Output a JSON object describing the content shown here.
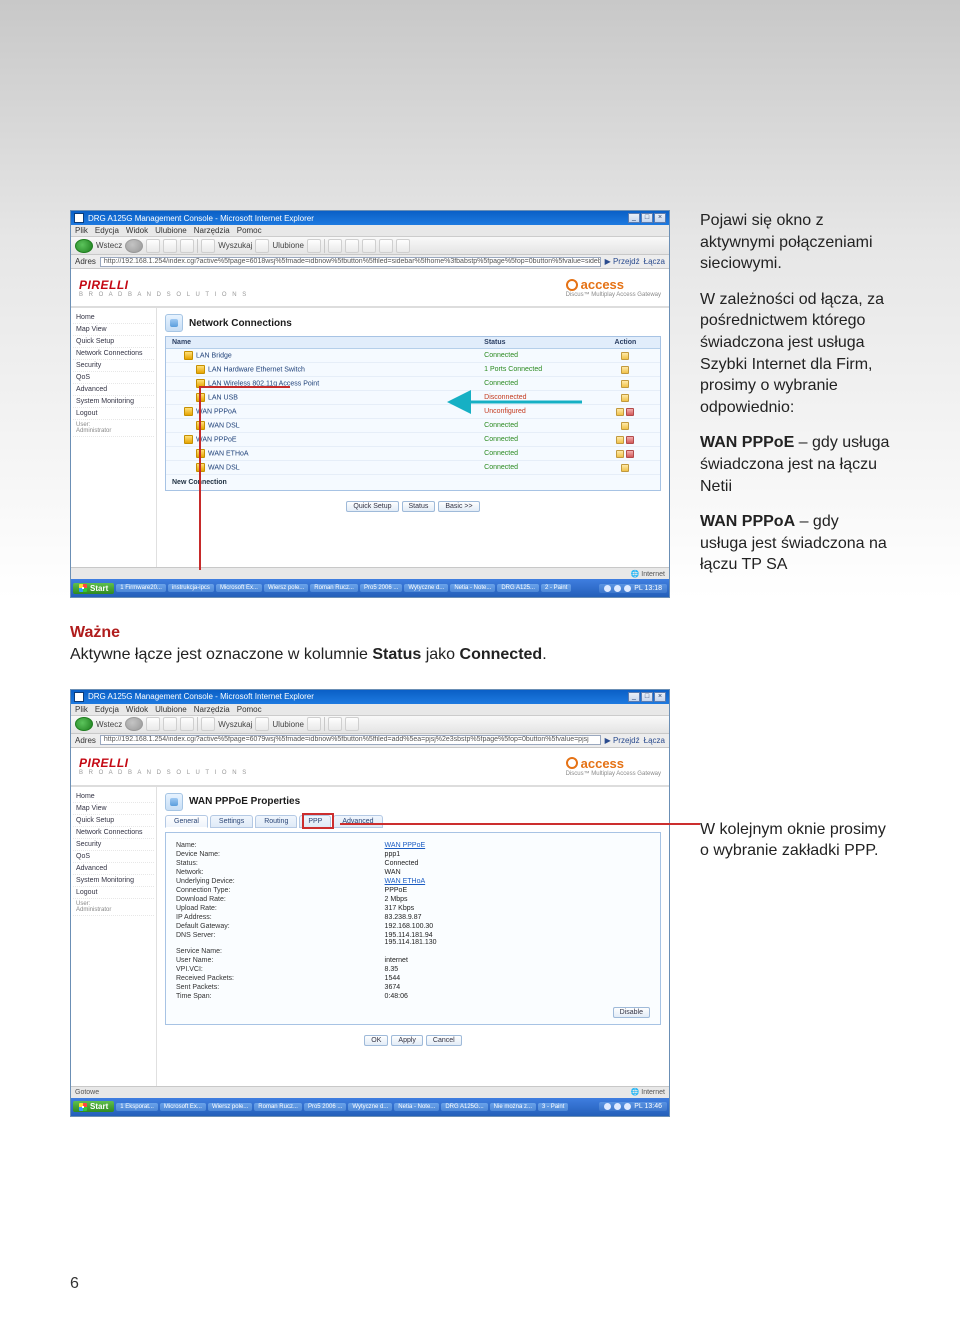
{
  "page_number": "6",
  "annotations": {
    "intro": "Pojawi się okno z aktywnymi połączeniami sieciowymi.",
    "depends": "W zależności od łącza, za pośrednictwem którego świadczona jest usługa Szybki Internet dla Firm, prosimy o wybranie odpowiednio:",
    "pppoe_label": "WAN PPPoE",
    "pppoe_rest": " – gdy usługa świadczona jest na łączu Netii",
    "pppoa_label": "WAN PPPoA",
    "pppoa_rest": " – gdy usługa jest świadczona na łączu TP SA",
    "important_header": "Ważne",
    "important_text_pre": "Aktywne łącze jest oznaczone w kolumnie ",
    "important_text_status": "Status",
    "important_text_mid": " jako ",
    "important_text_connected": "Connected",
    "important_text_end": ".",
    "ppp_callout_pre": "W kolejnym oknie prosimy o wybranie zakładki ",
    "ppp_callout_bold": "PPP",
    "ppp_callout_end": "."
  },
  "browser": {
    "window_title1": "DRG A125G Management Console - Microsoft Internet Explorer",
    "window_title2": "DRG A125G Management Console - Microsoft Internet Explorer",
    "menu": [
      "Plik",
      "Edycja",
      "Widok",
      "Ulubione",
      "Narzędzia",
      "Pomoc"
    ],
    "toolbar": {
      "back": "Wstecz",
      "search": "Wyszukaj",
      "favorites": "Ulubione"
    },
    "addr_label": "Adres",
    "url1": "http://192.168.1.254/index.cgi?active%5fpage=6018wsj%5fmade=idbnow%5fbutton%5ffiled=sidebar%5fhome%3fbabstp%5fpage%5fop=0button%5fvalue=sidebar%5fhome",
    "url2": "http://192.168.1.254/index.cgi?active%5fpage=6079wsj%5fmade=idbnow%5fbutton%5ffiled=add%5ea=pjsj%2e3sbstp%5fpage%5fop=0button%5fvalue=pjsj",
    "go": "Przejdź",
    "links": "Łącza",
    "status_done": "Gotowe",
    "status_zone": "Internet"
  },
  "router": {
    "brand": "PIRELLI",
    "brand_sub": "B R O A D B A N D\nS O L U T I O N S",
    "access": "access",
    "access_sub": "Discus™ Multiplay Access Gateway",
    "sidebar": [
      "Home",
      "Map View",
      "Quick Setup",
      "Network Connections",
      "Security",
      "QoS",
      "Advanced",
      "System Monitoring",
      "Logout"
    ],
    "sidebar_user": "User:\nAdministrator"
  },
  "shot1": {
    "panel_title": "Network Connections",
    "columns": [
      "Name",
      "Status",
      "Action"
    ],
    "rows": [
      {
        "indent": 1,
        "name": "LAN Bridge",
        "status": "Connected",
        "color": "green",
        "actions": 1
      },
      {
        "indent": 2,
        "name": "LAN Hardware Ethernet Switch",
        "status": "1 Ports Connected",
        "color": "green",
        "actions": 1
      },
      {
        "indent": 2,
        "name": "LAN Wireless 802.11g Access Point",
        "status": "Connected",
        "color": "green",
        "actions": 1
      },
      {
        "indent": 2,
        "name": "LAN USB",
        "status": "Disconnected",
        "color": "red",
        "actions": 1
      },
      {
        "indent": 1,
        "name": "WAN PPPoA",
        "status": "Unconfigured",
        "color": "red",
        "actions": 2
      },
      {
        "indent": 2,
        "name": "WAN DSL",
        "status": "Connected",
        "color": "green",
        "actions": 1
      },
      {
        "indent": 1,
        "name": "WAN PPPoE",
        "status": "Connected",
        "color": "green",
        "actions": 2
      },
      {
        "indent": 2,
        "name": "WAN ETHoA",
        "status": "Connected",
        "color": "green",
        "actions": 2
      },
      {
        "indent": 2,
        "name": "WAN DSL",
        "status": "Connected",
        "color": "green",
        "actions": 1
      }
    ],
    "new_connection": "New Connection",
    "buttons": [
      "Quick Setup",
      "Status",
      "Basic >>"
    ]
  },
  "shot2": {
    "panel_title": "WAN PPPoE Properties",
    "tabs": [
      "General",
      "Settings",
      "Routing",
      "PPP",
      "Advanced"
    ],
    "props": [
      {
        "k": "Name:",
        "v": "WAN PPPoE",
        "link": true
      },
      {
        "k": "Device Name:",
        "v": "ppp1"
      },
      {
        "k": "Status:",
        "v": "Connected"
      },
      {
        "k": "Network:",
        "v": "WAN"
      },
      {
        "k": "Underlying Device:",
        "v": "WAN ETHoA",
        "link": true
      },
      {
        "k": "Connection Type:",
        "v": "PPPoE"
      },
      {
        "k": "Download Rate:",
        "v": "2 Mbps"
      },
      {
        "k": "Upload Rate:",
        "v": "317 Kbps"
      },
      {
        "k": "IP Address:",
        "v": "83.238.9.87"
      },
      {
        "k": "Default Gateway:",
        "v": "192.168.100.30"
      },
      {
        "k": "DNS Server:",
        "v": "195.114.181.94\n195.114.181.130"
      },
      {
        "k": "Service Name:",
        "v": ""
      },
      {
        "k": "User Name:",
        "v": "internet"
      },
      {
        "k": "VPI.VCI:",
        "v": "8.35"
      },
      {
        "k": "Received Packets:",
        "v": "1544"
      },
      {
        "k": "Sent Packets:",
        "v": "3674"
      },
      {
        "k": "Time Span:",
        "v": "0:48:06"
      }
    ],
    "disable_btn": "Disable",
    "bottom_buttons": [
      "OK",
      "Apply",
      "Cancel"
    ]
  },
  "taskbar": {
    "start": "Start",
    "items1": [
      "1 Firmware20...",
      "instrukcja-ipcs",
      "Microsoft Ex...",
      "Wiersz pole...",
      "Roman Rucz...",
      "Pro5 2006 ...",
      "Wytyczne d...",
      "Netia - Note...",
      "DRG A125...",
      "2 - Paint"
    ],
    "items2": [
      "1 Eksporat...",
      "Microsoft Ex...",
      "Wiersz pole...",
      "Roman Rucz...",
      "Pro5 2006 ...",
      "Wytyczne d...",
      "Netia - Note...",
      "DRG A125G...",
      "Nie można z...",
      "3 - Paint"
    ],
    "clock1": "PL  13:18",
    "clock2": "PL  13:46"
  }
}
